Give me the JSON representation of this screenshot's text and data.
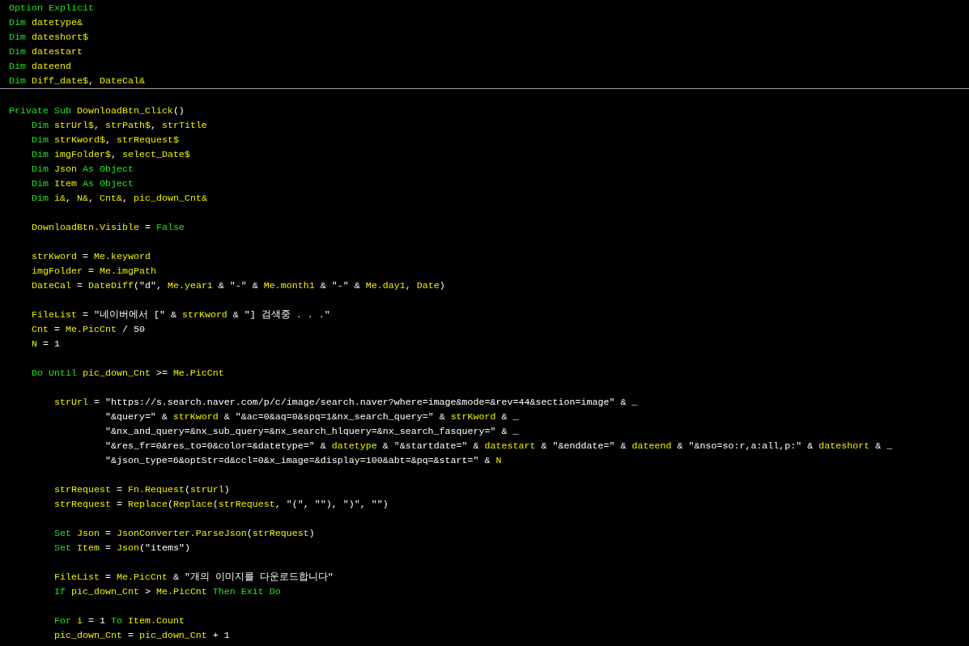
{
  "editor": {
    "sections": [
      {
        "lines": [
          {
            "kind": "code",
            "tokens": [
              {
                "kind": "keyword",
                "text": "Option Explicit"
              }
            ]
          },
          {
            "kind": "code",
            "tokens": [
              {
                "kind": "keyword",
                "text": "Dim "
              },
              {
                "kind": "name",
                "text": "datetype&"
              }
            ]
          },
          {
            "kind": "code",
            "tokens": [
              {
                "kind": "keyword",
                "text": "Dim "
              },
              {
                "kind": "name",
                "text": "dateshort$"
              }
            ]
          },
          {
            "kind": "code",
            "tokens": [
              {
                "kind": "keyword",
                "text": "Dim "
              },
              {
                "kind": "name",
                "text": "datestart"
              }
            ]
          },
          {
            "kind": "code",
            "tokens": [
              {
                "kind": "keyword",
                "text": "Dim "
              },
              {
                "kind": "name",
                "text": "dateend"
              }
            ]
          },
          {
            "kind": "code",
            "tokens": [
              {
                "kind": "keyword",
                "text": "Dim "
              },
              {
                "kind": "name",
                "text": "Diff_date$"
              },
              {
                "kind": "plain",
                "text": ", "
              },
              {
                "kind": "name",
                "text": "DateCal&"
              }
            ]
          }
        ]
      },
      {
        "lines": [
          {
            "kind": "blank"
          },
          {
            "kind": "code",
            "tokens": [
              {
                "kind": "keyword",
                "text": "Private Sub "
              },
              {
                "kind": "name",
                "text": "DownloadBtn_Click"
              },
              {
                "kind": "plain",
                "text": "()"
              }
            ]
          },
          {
            "kind": "code",
            "tokens": [
              {
                "kind": "keyword",
                "text": "    Dim "
              },
              {
                "kind": "name",
                "text": "strUrl$"
              },
              {
                "kind": "plain",
                "text": ", "
              },
              {
                "kind": "name",
                "text": "strPath$"
              },
              {
                "kind": "plain",
                "text": ", "
              },
              {
                "kind": "name",
                "text": "strTitle"
              }
            ]
          },
          {
            "kind": "code",
            "tokens": [
              {
                "kind": "keyword",
                "text": "    Dim "
              },
              {
                "kind": "name",
                "text": "strKword$"
              },
              {
                "kind": "plain",
                "text": ", "
              },
              {
                "kind": "name",
                "text": "strRequest$"
              }
            ]
          },
          {
            "kind": "code",
            "tokens": [
              {
                "kind": "keyword",
                "text": "    Dim "
              },
              {
                "kind": "name",
                "text": "imgFolder$"
              },
              {
                "kind": "plain",
                "text": ", "
              },
              {
                "kind": "name",
                "text": "select_Date$"
              }
            ]
          },
          {
            "kind": "code",
            "tokens": [
              {
                "kind": "keyword",
                "text": "    Dim "
              },
              {
                "kind": "name",
                "text": "Json "
              },
              {
                "kind": "keyword",
                "text": "As Object"
              }
            ]
          },
          {
            "kind": "code",
            "tokens": [
              {
                "kind": "keyword",
                "text": "    Dim "
              },
              {
                "kind": "name",
                "text": "Item "
              },
              {
                "kind": "keyword",
                "text": "As Object"
              }
            ]
          },
          {
            "kind": "code",
            "tokens": [
              {
                "kind": "keyword",
                "text": "    Dim "
              },
              {
                "kind": "name",
                "text": "i&"
              },
              {
                "kind": "plain",
                "text": ", "
              },
              {
                "kind": "name",
                "text": "N&"
              },
              {
                "kind": "plain",
                "text": ", "
              },
              {
                "kind": "name",
                "text": "Cnt&"
              },
              {
                "kind": "plain",
                "text": ", "
              },
              {
                "kind": "name",
                "text": "pic_down_Cnt&"
              }
            ]
          },
          {
            "kind": "blank"
          },
          {
            "kind": "code",
            "tokens": [
              {
                "kind": "name",
                "text": "    DownloadBtn.Visible"
              },
              {
                "kind": "plain",
                "text": " = "
              },
              {
                "kind": "keyword",
                "text": "False"
              }
            ]
          },
          {
            "kind": "blank"
          },
          {
            "kind": "code",
            "tokens": [
              {
                "kind": "name",
                "text": "    strKword"
              },
              {
                "kind": "plain",
                "text": " = "
              },
              {
                "kind": "name",
                "text": "Me.keyword"
              }
            ]
          },
          {
            "kind": "code",
            "tokens": [
              {
                "kind": "name",
                "text": "    imgFolder"
              },
              {
                "kind": "plain",
                "text": " = "
              },
              {
                "kind": "name",
                "text": "Me.imgPath"
              }
            ]
          },
          {
            "kind": "code",
            "tokens": [
              {
                "kind": "name",
                "text": "    DateCal"
              },
              {
                "kind": "plain",
                "text": " = "
              },
              {
                "kind": "name",
                "text": "DateDiff"
              },
              {
                "kind": "plain",
                "text": "(\"d\", "
              },
              {
                "kind": "name",
                "text": "Me.year1"
              },
              {
                "kind": "plain",
                "text": " & \"-\" & "
              },
              {
                "kind": "name",
                "text": "Me.month1"
              },
              {
                "kind": "plain",
                "text": " & \"-\" & "
              },
              {
                "kind": "name",
                "text": "Me.day1"
              },
              {
                "kind": "plain",
                "text": ", "
              },
              {
                "kind": "name",
                "text": "Date"
              },
              {
                "kind": "plain",
                "text": ")"
              }
            ]
          },
          {
            "kind": "blank"
          },
          {
            "kind": "code",
            "tokens": [
              {
                "kind": "name",
                "text": "    FileList"
              },
              {
                "kind": "plain",
                "text": " = \"네이버에서 [\" & "
              },
              {
                "kind": "name",
                "text": "strKword"
              },
              {
                "kind": "plain",
                "text": " & \"] 검색중 . . .\""
              }
            ]
          },
          {
            "kind": "code",
            "tokens": [
              {
                "kind": "name",
                "text": "    Cnt"
              },
              {
                "kind": "plain",
                "text": " = "
              },
              {
                "kind": "name",
                "text": "Me.PicCnt"
              },
              {
                "kind": "plain",
                "text": " / 50"
              }
            ]
          },
          {
            "kind": "code",
            "tokens": [
              {
                "kind": "name",
                "text": "    N"
              },
              {
                "kind": "plain",
                "text": " = 1"
              }
            ]
          },
          {
            "kind": "blank"
          },
          {
            "kind": "code",
            "tokens": [
              {
                "kind": "keyword",
                "text": "    Do Until "
              },
              {
                "kind": "name",
                "text": "pic_down_Cnt"
              },
              {
                "kind": "plain",
                "text": " >= "
              },
              {
                "kind": "name",
                "text": "Me.PicCnt"
              }
            ]
          },
          {
            "kind": "blank"
          },
          {
            "kind": "code",
            "tokens": [
              {
                "kind": "name",
                "text": "        strUrl"
              },
              {
                "kind": "plain",
                "text": " = \"https://s.search.naver.com/p/c/image/search.naver?where=image&mode=&rev=44&section=image\" & _"
              }
            ]
          },
          {
            "kind": "code",
            "tokens": [
              {
                "kind": "plain",
                "text": "                 \"&query=\" & "
              },
              {
                "kind": "name",
                "text": "strKword"
              },
              {
                "kind": "plain",
                "text": " & \"&ac=0&aq=0&spq=1&nx_search_query=\" & "
              },
              {
                "kind": "name",
                "text": "strKword"
              },
              {
                "kind": "plain",
                "text": " & _"
              }
            ]
          },
          {
            "kind": "code",
            "tokens": [
              {
                "kind": "plain",
                "text": "                 \"&nx_and_query=&nx_sub_query=&nx_search_hlquery=&nx_search_fasquery=\" & _"
              }
            ]
          },
          {
            "kind": "code",
            "tokens": [
              {
                "kind": "plain",
                "text": "                 \"&res_fr=0&res_to=0&color=&datetype=\" & "
              },
              {
                "kind": "name",
                "text": "datetype"
              },
              {
                "kind": "plain",
                "text": " & \"&startdate=\" & "
              },
              {
                "kind": "name",
                "text": "datestart"
              },
              {
                "kind": "plain",
                "text": " & \"&enddate=\" & "
              },
              {
                "kind": "name",
                "text": "dateend"
              },
              {
                "kind": "plain",
                "text": " & \"&nso=so:r,a:all,p:\" & "
              },
              {
                "kind": "name",
                "text": "dateshort"
              },
              {
                "kind": "plain",
                "text": " & _"
              }
            ]
          },
          {
            "kind": "code",
            "tokens": [
              {
                "kind": "plain",
                "text": "                 \"&json_type=6&optStr=d&ccl=0&x_image=&display=100&abt=&pq=&start=\" & "
              },
              {
                "kind": "name",
                "text": "N"
              }
            ]
          },
          {
            "kind": "blank"
          },
          {
            "kind": "code",
            "tokens": [
              {
                "kind": "name",
                "text": "        strRequest"
              },
              {
                "kind": "plain",
                "text": " = "
              },
              {
                "kind": "name",
                "text": "Fn.Request"
              },
              {
                "kind": "plain",
                "text": "("
              },
              {
                "kind": "name",
                "text": "strUrl"
              },
              {
                "kind": "plain",
                "text": ")"
              }
            ]
          },
          {
            "kind": "code",
            "tokens": [
              {
                "kind": "name",
                "text": "        strRequest"
              },
              {
                "kind": "plain",
                "text": " = "
              },
              {
                "kind": "name",
                "text": "Replace"
              },
              {
                "kind": "plain",
                "text": "("
              },
              {
                "kind": "name",
                "text": "Replace"
              },
              {
                "kind": "plain",
                "text": "("
              },
              {
                "kind": "name",
                "text": "strRequest"
              },
              {
                "kind": "plain",
                "text": ", \"(\", \"\"), \")\", \"\")"
              }
            ]
          },
          {
            "kind": "blank"
          },
          {
            "kind": "code",
            "tokens": [
              {
                "kind": "keyword",
                "text": "        Set "
              },
              {
                "kind": "name",
                "text": "Json"
              },
              {
                "kind": "plain",
                "text": " = "
              },
              {
                "kind": "name",
                "text": "JsonConverter.ParseJson"
              },
              {
                "kind": "plain",
                "text": "("
              },
              {
                "kind": "name",
                "text": "strRequest"
              },
              {
                "kind": "plain",
                "text": ")"
              }
            ]
          },
          {
            "kind": "code",
            "tokens": [
              {
                "kind": "keyword",
                "text": "        Set "
              },
              {
                "kind": "name",
                "text": "Item"
              },
              {
                "kind": "plain",
                "text": " = "
              },
              {
                "kind": "name",
                "text": "Json"
              },
              {
                "kind": "plain",
                "text": "(\"items\")"
              }
            ]
          },
          {
            "kind": "blank"
          },
          {
            "kind": "code",
            "tokens": [
              {
                "kind": "name",
                "text": "        FileList"
              },
              {
                "kind": "plain",
                "text": " = "
              },
              {
                "kind": "name",
                "text": "Me.PicCnt"
              },
              {
                "kind": "plain",
                "text": " & \"개의 이미지를 다운로드합니다\""
              }
            ]
          },
          {
            "kind": "code",
            "tokens": [
              {
                "kind": "keyword",
                "text": "        If "
              },
              {
                "kind": "name",
                "text": "pic_down_Cnt"
              },
              {
                "kind": "plain",
                "text": " > "
              },
              {
                "kind": "name",
                "text": "Me.PicCnt "
              },
              {
                "kind": "keyword",
                "text": "Then Exit Do"
              }
            ]
          },
          {
            "kind": "blank"
          },
          {
            "kind": "code",
            "tokens": [
              {
                "kind": "keyword",
                "text": "        For "
              },
              {
                "kind": "name",
                "text": "i"
              },
              {
                "kind": "plain",
                "text": " = 1 "
              },
              {
                "kind": "keyword",
                "text": "To "
              },
              {
                "kind": "name",
                "text": "Item.Count"
              }
            ]
          },
          {
            "kind": "code",
            "tokens": [
              {
                "kind": "name",
                "text": "        pic_down_Cnt"
              },
              {
                "kind": "plain",
                "text": " = "
              },
              {
                "kind": "name",
                "text": "pic_down_Cnt"
              },
              {
                "kind": "plain",
                "text": " + 1"
              }
            ]
          }
        ]
      }
    ]
  }
}
